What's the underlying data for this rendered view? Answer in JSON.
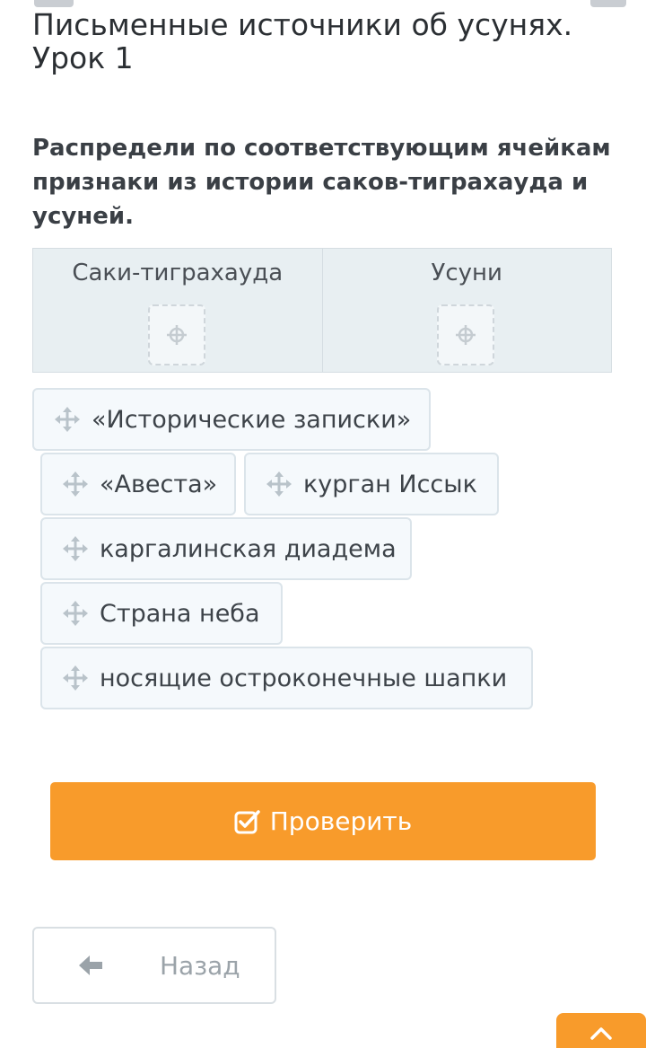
{
  "lesson": {
    "title": "Письменные источники об усунях. Урок 1"
  },
  "task": {
    "instruction": "Распредели по соответствующим ячейкам признаки из истории саков-тиграхауда и усуней."
  },
  "table": {
    "columns": [
      {
        "header": "Саки-тиграхауда",
        "slot_icon": "crosshair-icon"
      },
      {
        "header": "Усуни",
        "slot_icon": "crosshair-icon"
      }
    ]
  },
  "options": [
    {
      "label": "«Исторические записки»",
      "icon": "move-icon"
    },
    {
      "label": "«Авеста»",
      "icon": "move-icon"
    },
    {
      "label": "курган Иссык",
      "icon": "move-icon"
    },
    {
      "label": "каргалинская диадема",
      "icon": "move-icon"
    },
    {
      "label": "Страна неба",
      "icon": "move-icon"
    },
    {
      "label": "носящие остроконечные шапки",
      "icon": "move-icon"
    }
  ],
  "actions": {
    "check_label": "Проверить",
    "back_label": "Назад"
  },
  "colors": {
    "accent": "#f89b2b",
    "table_bg": "#e8eff2",
    "chip_bg": "#f5f9fc"
  }
}
